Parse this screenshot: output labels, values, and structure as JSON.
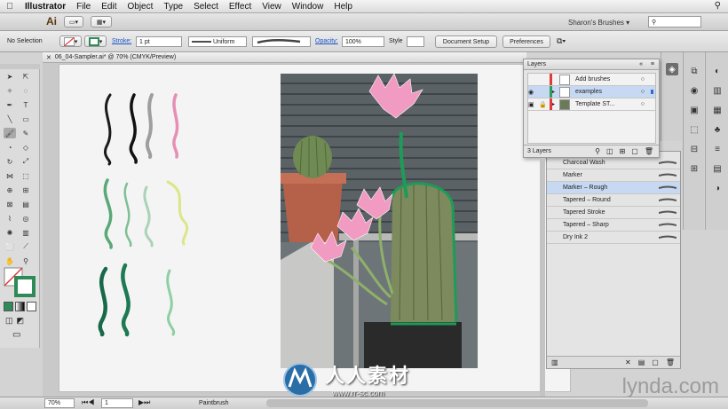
{
  "menubar": {
    "apple": "",
    "app": "Illustrator",
    "items": [
      "File",
      "Edit",
      "Object",
      "Type",
      "Select",
      "Effect",
      "View",
      "Window",
      "Help"
    ]
  },
  "appbar": {
    "logo": "Ai",
    "workspace": "Sharon's Brushes"
  },
  "control": {
    "selection": "No Selection",
    "stroke_label": "Stroke:",
    "stroke_weight": "1 pt",
    "profile": "Uniform",
    "opacity_label": "Opacity:",
    "opacity": "100%",
    "style_label": "Style",
    "doc_setup": "Document Setup",
    "preferences": "Preferences"
  },
  "document": {
    "tab": "06_04-Sampler.ai* @ 70% (CMYK/Preview)"
  },
  "layers": {
    "title": "Layers",
    "rows": [
      {
        "name": "Add brushes"
      },
      {
        "name": "examples"
      },
      {
        "name": "Template ST..."
      }
    ],
    "count": "3 Layers"
  },
  "brushes": {
    "items": [
      "Charcoal Wash",
      "Marker",
      "Marker – Rough",
      "Tapered – Round",
      "Tapered Stroke",
      "Tapered – Sharp",
      "Dry Ink 2"
    ],
    "selected_index": 2
  },
  "status": {
    "zoom": "70%",
    "page": "1",
    "tool": "Paintbrush"
  },
  "watermark": {
    "brand": "lynda.com",
    "site_cn": "人人素材",
    "site_url": "www.rr-sc.com"
  },
  "colors": {
    "selection_blue": "#c6d8f2",
    "stroke_green": "#2e8b57",
    "layer_red": "#e03a3a"
  }
}
